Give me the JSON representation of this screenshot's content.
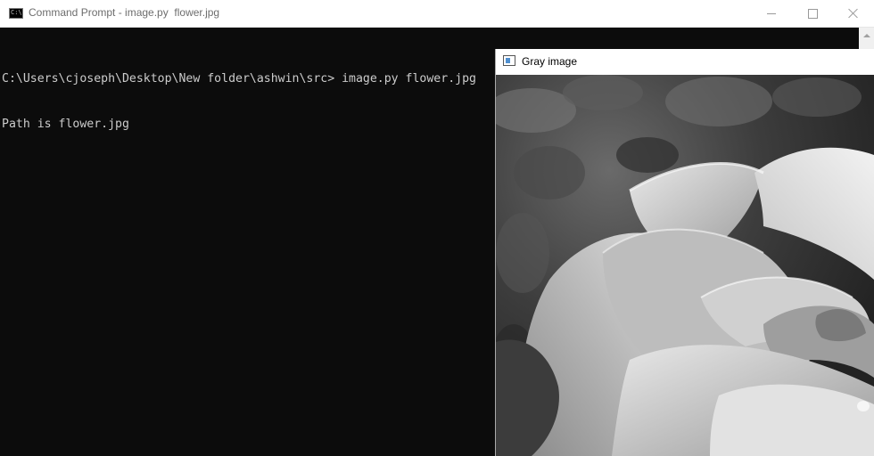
{
  "cmd_window": {
    "title": "Command Prompt - image.py  flower.jpg",
    "icon": "cmd-icon",
    "icon_label": "C:\\"
  },
  "window_controls": {
    "minimize": "minimize-icon",
    "maximize": "maximize-icon",
    "close": "close-icon"
  },
  "console": {
    "lines": [
      "C:\\Users\\cjoseph\\Desktop\\New folder\\ashwin\\src> image.py flower.jpg",
      "Path is flower.jpg"
    ]
  },
  "image_window": {
    "title": "Gray image",
    "icon": "image-window-icon",
    "image": "grayscale-rose-photo"
  },
  "colors": {
    "console_bg": "#0c0c0c",
    "console_text": "#cccccc",
    "titlebar_bg": "#ffffff"
  }
}
